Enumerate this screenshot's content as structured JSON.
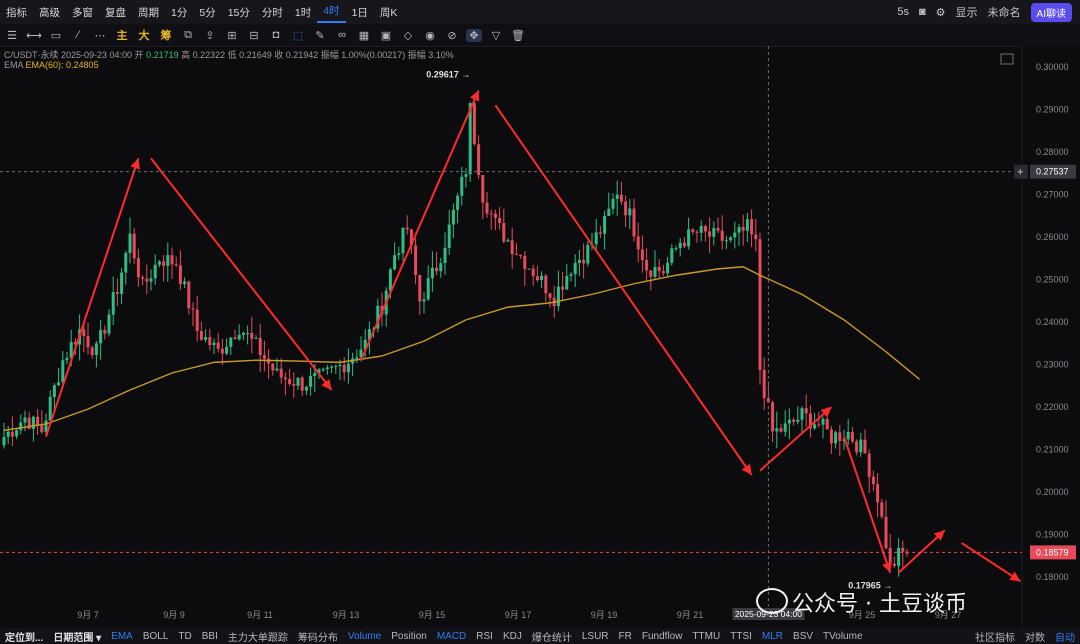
{
  "topbar": {
    "items": [
      "指标",
      "高级",
      "多窗",
      "复盘",
      "周期",
      "1分",
      "5分",
      "15分",
      "分时",
      "1时",
      "4时",
      "1日",
      "周K"
    ],
    "active_index": 10,
    "right": {
      "interval": "5s",
      "display": "显示",
      "account": "未命名",
      "ai": "AI聊读"
    }
  },
  "toolbar": {
    "gold_labels": [
      "主",
      "大",
      "筹"
    ]
  },
  "info": {
    "line1_pre": "C/USDT·永续  2025-09-23 04:00  开",
    "open": "0.21719",
    "rest": "  高 0.22322  低 0.21649  收 0.21942  振幅 1.00%(0.00217)  振幅 3.10%",
    "line2_label": "EMA",
    "ema": "EMA(60): 0.24805"
  },
  "watermark": "公众号 · 土豆谈币",
  "bottombar": {
    "left": [
      "定位到...",
      "日期范围 ▾"
    ],
    "indicators": [
      "EMA",
      "BOLL",
      "TD",
      "BBI",
      "主力大单跟踪",
      "筹码分布",
      "Volume",
      "Position",
      "MACD",
      "RSI",
      "KDJ",
      "爆仓统计",
      "LSUR",
      "FR",
      "Fundflow",
      "TTMU",
      "TTSI",
      "MLR",
      "BSV",
      "TVolume"
    ],
    "blue": [
      "EMA",
      "Volume",
      "MACD",
      "MLR"
    ],
    "right": [
      "社区指标",
      "对数",
      "自动"
    ]
  },
  "chart_data": {
    "type": "candlestick",
    "interval": "4h",
    "y_ticks": [
      "0.30000",
      "0.29000",
      "0.28000",
      "0.27000",
      "0.26000",
      "0.25000",
      "0.24000",
      "0.23000",
      "0.22000",
      "0.21000",
      "0.20000",
      "0.19000",
      "0.18000"
    ],
    "ylim": [
      0.176,
      0.302
    ],
    "x_ticks": [
      "9月 7",
      "9月 9",
      "9月 11",
      "9月 13",
      "9月 15",
      "9月 17",
      "9月 19",
      "9月 21",
      "9月 23",
      "9月 25",
      "9月 27"
    ],
    "x_tick_positions": [
      8,
      28,
      48,
      68,
      88,
      108,
      128,
      148,
      168,
      188,
      208
    ],
    "last_price": "0.18579",
    "last_value": 0.18579,
    "crosshair_price": "0.27537",
    "crosshair_value": 0.27537,
    "crosshair_time": "2025-09-23 04:00",
    "crosshair_index": 182,
    "high_label": "0.29617",
    "high_value": 0.29617,
    "high_index": 111,
    "low_label": "0.17965",
    "low_value": 0.17965,
    "low_index": 211,
    "ema_label": "EMA(60)",
    "ema_value": 0.24805,
    "ema": [
      [
        0,
        0.2145
      ],
      [
        10,
        0.216
      ],
      [
        20,
        0.2195
      ],
      [
        30,
        0.224
      ],
      [
        40,
        0.228
      ],
      [
        50,
        0.2305
      ],
      [
        60,
        0.231
      ],
      [
        70,
        0.2308
      ],
      [
        80,
        0.2305
      ],
      [
        90,
        0.232
      ],
      [
        100,
        0.2355
      ],
      [
        110,
        0.2405
      ],
      [
        120,
        0.2435
      ],
      [
        130,
        0.2445
      ],
      [
        140,
        0.2465
      ],
      [
        150,
        0.249
      ],
      [
        160,
        0.251
      ],
      [
        170,
        0.2525
      ],
      [
        176,
        0.253
      ],
      [
        180,
        0.251
      ],
      [
        190,
        0.2465
      ],
      [
        200,
        0.2405
      ],
      [
        210,
        0.233
      ],
      [
        218,
        0.2265
      ]
    ],
    "anchors": [
      [
        0,
        0.213
      ],
      [
        5,
        0.2175
      ],
      [
        9,
        0.2145
      ],
      [
        14,
        0.231
      ],
      [
        18,
        0.238
      ],
      [
        22,
        0.233
      ],
      [
        27,
        0.248
      ],
      [
        30,
        0.26
      ],
      [
        33,
        0.248
      ],
      [
        37,
        0.255
      ],
      [
        41,
        0.254
      ],
      [
        46,
        0.238
      ],
      [
        51,
        0.233
      ],
      [
        56,
        0.239
      ],
      [
        61,
        0.233
      ],
      [
        65,
        0.2275
      ],
      [
        71,
        0.2255
      ],
      [
        76,
        0.227
      ],
      [
        82,
        0.231
      ],
      [
        86,
        0.235
      ],
      [
        90,
        0.244
      ],
      [
        93,
        0.256
      ],
      [
        96,
        0.262
      ],
      [
        99,
        0.245
      ],
      [
        103,
        0.253
      ],
      [
        106,
        0.262
      ],
      [
        110,
        0.276
      ],
      [
        111,
        0.29
      ],
      [
        114,
        0.27
      ],
      [
        117,
        0.263
      ],
      [
        121,
        0.258
      ],
      [
        126,
        0.252
      ],
      [
        131,
        0.246
      ],
      [
        135,
        0.253
      ],
      [
        139,
        0.257
      ],
      [
        143,
        0.263
      ],
      [
        146,
        0.271
      ],
      [
        149,
        0.265
      ],
      [
        153,
        0.253
      ],
      [
        157,
        0.252
      ],
      [
        161,
        0.259
      ],
      [
        165,
        0.261
      ],
      [
        169,
        0.26
      ],
      [
        173,
        0.259
      ],
      [
        177,
        0.262
      ],
      [
        179,
        0.258
      ],
      [
        180,
        0.229
      ],
      [
        183,
        0.214
      ],
      [
        186,
        0.215
      ],
      [
        190,
        0.218
      ],
      [
        194,
        0.216
      ],
      [
        197,
        0.213
      ],
      [
        201,
        0.214
      ],
      [
        205,
        0.209
      ],
      [
        208,
        0.199
      ],
      [
        210,
        0.188
      ],
      [
        211,
        0.182
      ],
      [
        213,
        0.185
      ],
      [
        215,
        0.186
      ]
    ],
    "arrows": [
      [
        [
          10,
          0.213
        ],
        [
          32,
          0.2785
        ]
      ],
      [
        [
          35,
          0.2785
        ],
        [
          78,
          0.224
        ]
      ],
      [
        [
          85,
          0.231
        ],
        [
          113,
          0.2945
        ]
      ],
      [
        [
          117,
          0.291
        ],
        [
          178,
          0.204
        ]
      ],
      [
        [
          180,
          0.205
        ],
        [
          197,
          0.22
        ]
      ],
      [
        [
          200,
          0.213
        ],
        [
          211,
          0.181
        ]
      ],
      [
        [
          213,
          0.181
        ],
        [
          224,
          0.191
        ]
      ],
      [
        [
          228,
          0.188
        ],
        [
          242,
          0.179
        ]
      ]
    ]
  }
}
